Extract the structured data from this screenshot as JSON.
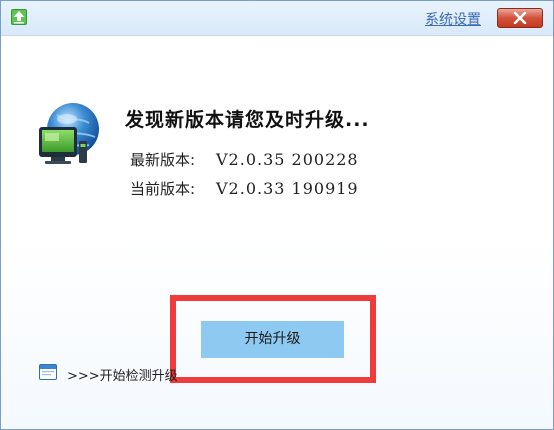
{
  "titlebar": {
    "icon": "upload-icon",
    "settings_label": "系统设置",
    "close_icon": "close-icon"
  },
  "main": {
    "icon": "globe-monitor-icon",
    "headline": "发现新版本请您及时升级...",
    "latest_version_label": "最新版本:",
    "latest_version_value": "V2.0.35 200228",
    "current_version_label": "当前版本:",
    "current_version_value": "V2.0.33 190919",
    "start_button_label": "开始升级"
  },
  "footer": {
    "icon": "window-icon",
    "check_label": ">>>开始检测升级"
  },
  "colors": {
    "titlebar": "#dcebfa",
    "close_button": "#d2513b",
    "start_button": "#8ec9f2",
    "highlight": "#ee3b3b",
    "link": "#3a6ab8"
  }
}
